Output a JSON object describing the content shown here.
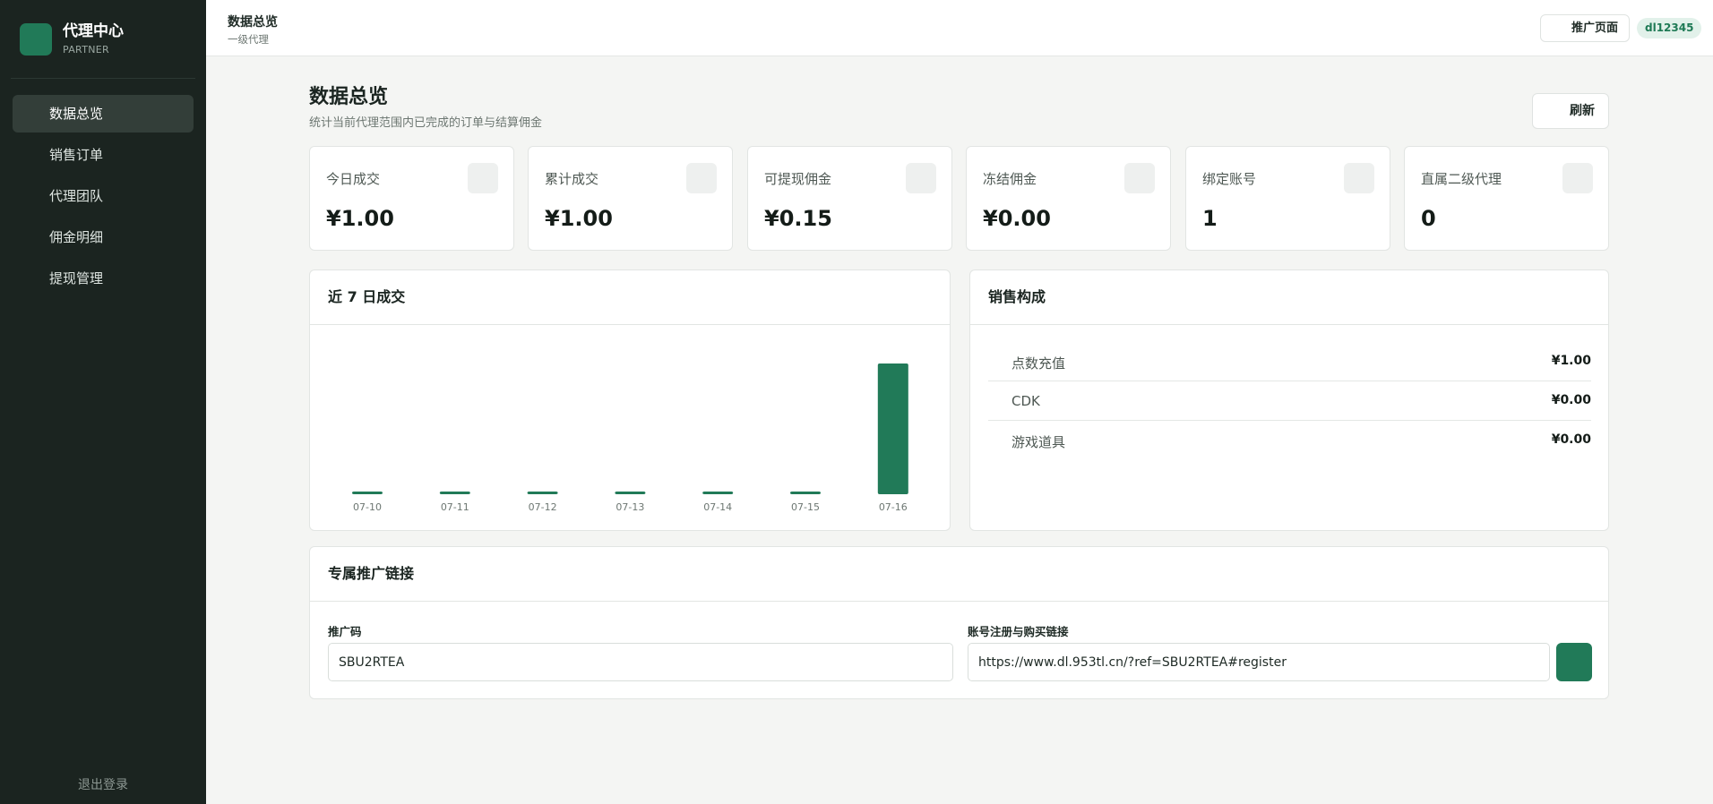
{
  "sidebar": {
    "brand_title": "代理中心",
    "brand_sub": "PARTNER",
    "items": [
      {
        "label": "数据总览",
        "active": true
      },
      {
        "label": "销售订单"
      },
      {
        "label": "代理团队"
      },
      {
        "label": "佣金明细"
      },
      {
        "label": "提现管理"
      }
    ],
    "logout_label": "退出登录"
  },
  "topbar": {
    "title": "数据总览",
    "subtitle": "一级代理",
    "promo_label": "推广页面",
    "user": "dl12345"
  },
  "main": {
    "title": "数据总览",
    "desc": "统计当前代理范围内已完成的订单与结算佣金",
    "refresh_label": "刷新"
  },
  "stats": [
    {
      "label": "今日成交",
      "value": "¥1.00"
    },
    {
      "label": "累计成交",
      "value": "¥1.00"
    },
    {
      "label": "可提现佣金",
      "value": "¥0.15"
    },
    {
      "label": "冻结佣金",
      "value": "¥0.00"
    },
    {
      "label": "绑定账号",
      "value": "1"
    },
    {
      "label": "直属二级代理",
      "value": "0"
    }
  ],
  "chart_panel": {
    "title": "近 7 日成交"
  },
  "chart_data": {
    "type": "bar",
    "categories": [
      "07-10",
      "07-11",
      "07-12",
      "07-13",
      "07-14",
      "07-15",
      "07-16"
    ],
    "values": [
      0,
      0,
      0,
      0,
      0,
      0,
      1.0
    ],
    "title": "近 7 日成交",
    "xlabel": "",
    "ylabel": "",
    "ylim": [
      0,
      1.0
    ],
    "color": "#217a58",
    "grid": false
  },
  "sales_panel": {
    "title": "销售构成",
    "rows": [
      {
        "name": "点数充值",
        "value": "¥1.00"
      },
      {
        "name": "CDK",
        "value": "¥0.00"
      },
      {
        "name": "游戏道具",
        "value": "¥0.00"
      }
    ]
  },
  "link_panel": {
    "title": "专属推广链接",
    "code_label": "推广码",
    "code_value": "SBU2RTEA",
    "link_label": "账号注册与购买链接",
    "link_value": "https://www.dl.953tl.cn/?ref=SBU2RTEA#register"
  },
  "colors": {
    "accent": "#217a58",
    "sidebar_bg": "#1b2420",
    "page_bg": "#f4f5f3"
  }
}
